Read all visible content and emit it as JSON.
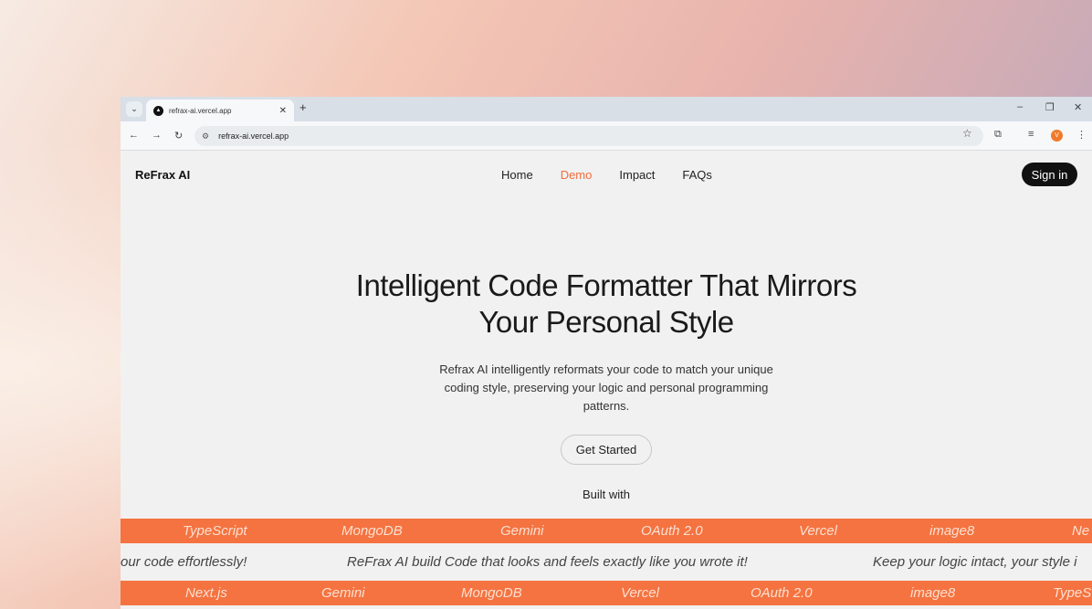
{
  "browser": {
    "tab_title": "refrax-ai.vercel.app",
    "url": "refrax-ai.vercel.app",
    "profile_initial": "V",
    "icons": {
      "tab_menu": "chevron-down-icon",
      "close_tab": "close-icon",
      "new_tab": "plus-icon",
      "back": "arrow-left-icon",
      "forward": "arrow-right-icon",
      "reload": "reload-icon",
      "site_info": "tune-icon",
      "bookmark": "star-icon",
      "extensions": "puzzle-icon",
      "media": "media-control-icon",
      "menu": "kebab-menu-icon"
    }
  },
  "nav": {
    "brand": "ReFrax AI",
    "items": [
      "Home",
      "Demo",
      "Impact",
      "FAQs"
    ],
    "active": "Demo",
    "sign_in": "Sign in"
  },
  "hero": {
    "title_line1": "Intelligent Code Formatter That Mirrors",
    "title_line2": "Your Personal Style",
    "subtitle": "Refrax AI intelligently reformats your code to match your unique coding style, preserving your logic and personal programming patterns.",
    "cta": "Get Started",
    "built_with": "Built with"
  },
  "marquee1": [
    "TypeScript",
    "MongoDB",
    "Gemini",
    "OAuth 2.0",
    "Vercel",
    "image8",
    "Ne"
  ],
  "marquee2": [
    "our code effortlessly!",
    "ReFrax AI build Code that looks and feels exactly like you wrote it!",
    "Keep your logic intact, your style i"
  ],
  "marquee3": [
    "Next.js",
    "Gemini",
    "MongoDB",
    "Vercel",
    "OAuth 2.0",
    "image8",
    "TypeS"
  ],
  "colors": {
    "accent": "#f47340",
    "nav_active": "#f06d3b",
    "sign_in_bg": "#111111"
  }
}
